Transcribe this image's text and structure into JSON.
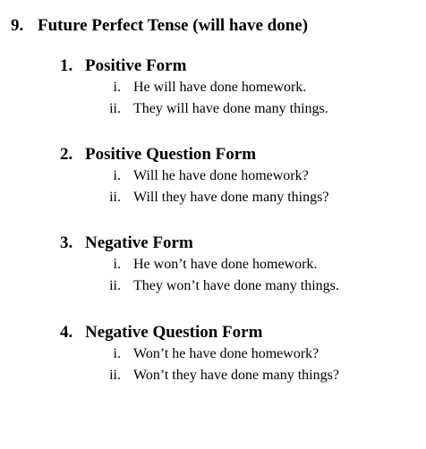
{
  "heading": {
    "number": "9.",
    "text": "Future Perfect Tense (will have done)"
  },
  "sections": [
    {
      "number": "1.",
      "title": "Positive Form",
      "items": [
        {
          "marker": "i.",
          "text": "He will have done homework."
        },
        {
          "marker": "ii.",
          "text": "They will have done many things."
        }
      ]
    },
    {
      "number": "2.",
      "title": "Positive Question Form",
      "items": [
        {
          "marker": "i.",
          "text": "Will he have done homework?"
        },
        {
          "marker": "ii.",
          "text": "Will they have done many things?"
        }
      ]
    },
    {
      "number": "3.",
      "title": "Negative Form",
      "items": [
        {
          "marker": "i.",
          "text": "He won’t have done homework."
        },
        {
          "marker": "ii.",
          "text": "They won’t have done many things."
        }
      ]
    },
    {
      "number": "4.",
      "title": "Negative Question Form",
      "items": [
        {
          "marker": "i.",
          "text": "Won’t he have done homework?"
        },
        {
          "marker": "ii.",
          "text": "Won’t they have done many things?"
        }
      ]
    }
  ]
}
